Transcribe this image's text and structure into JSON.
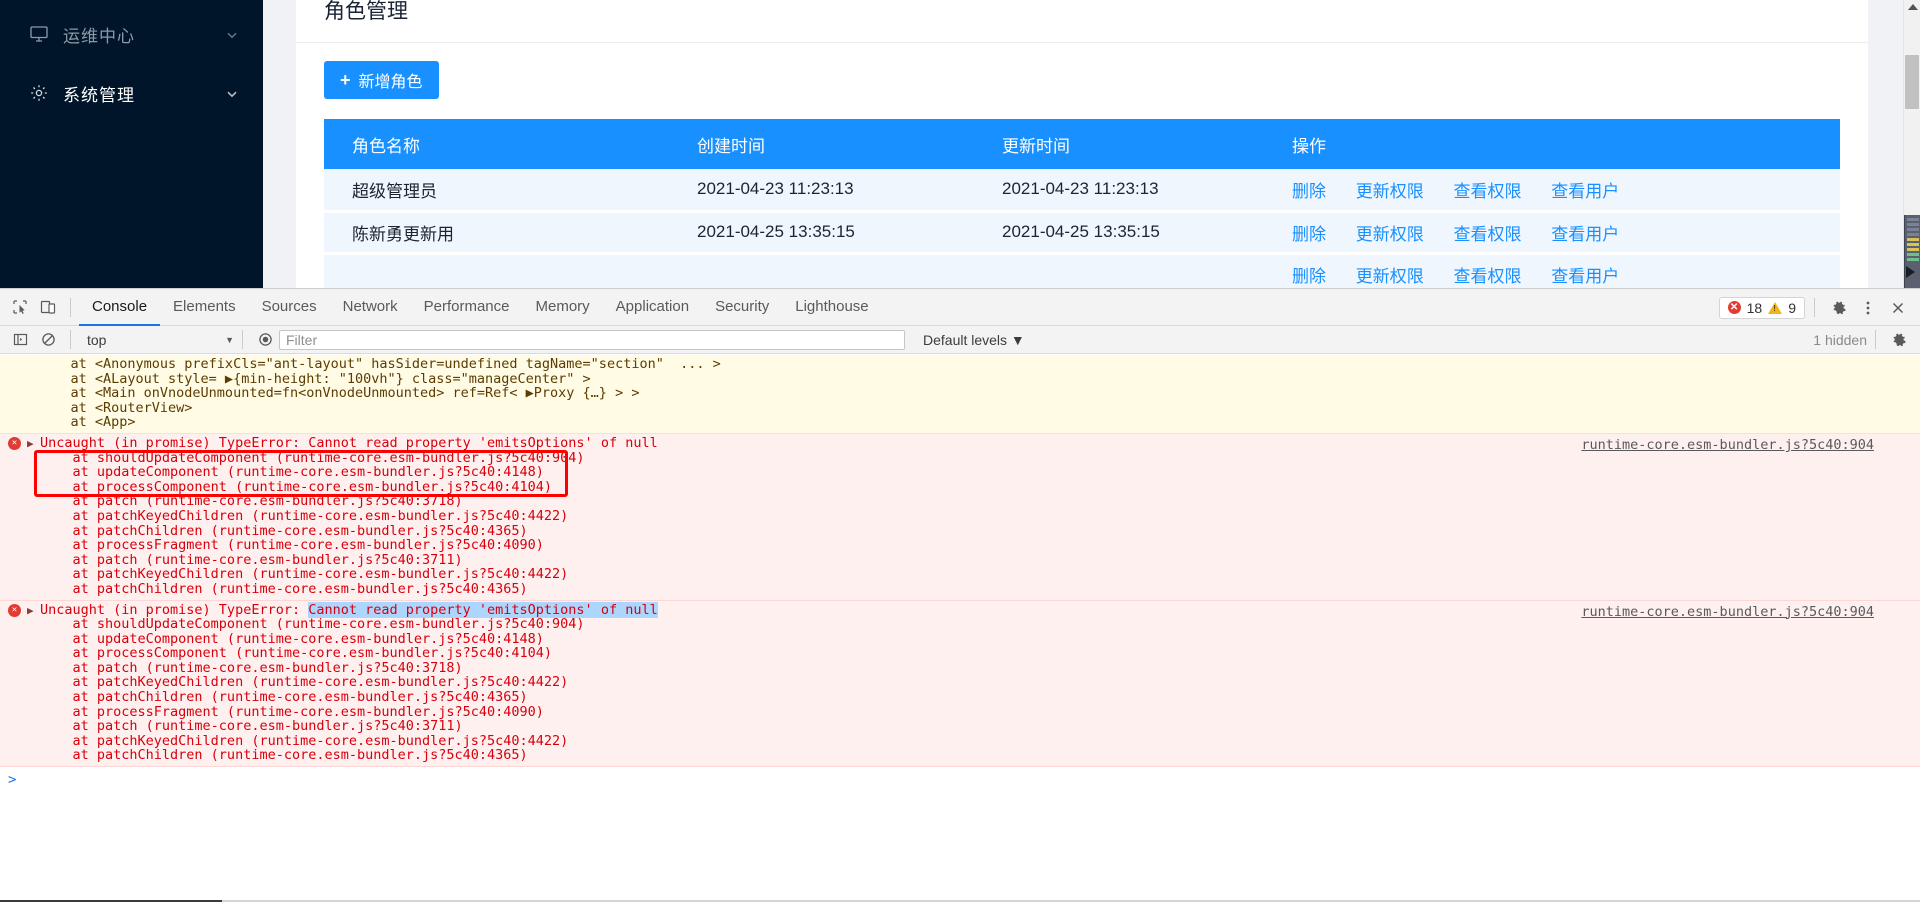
{
  "sidebar": {
    "items": [
      {
        "label": "运维中心",
        "icon": "monitor-icon",
        "active": false
      },
      {
        "label": "系统管理",
        "icon": "gear-icon",
        "active": true
      }
    ]
  },
  "page": {
    "title": "角色管理",
    "add_button": "新增角色",
    "add_button_plus": "+",
    "table": {
      "headers": [
        "角色名称",
        "创建时间",
        "更新时间",
        "操作"
      ],
      "rows": [
        {
          "name": "超级管理员",
          "created": "2021-04-23 11:23:13",
          "updated": "2021-04-23 11:23:13",
          "ops": [
            "删除",
            "更新权限",
            "查看权限",
            "查看用户"
          ]
        },
        {
          "name": "陈新勇更新用",
          "created": "2021-04-25 13:35:15",
          "updated": "2021-04-25 13:35:15",
          "ops": [
            "删除",
            "更新权限",
            "查看权限",
            "查看用户"
          ]
        },
        {
          "name": "",
          "created": "",
          "updated": "",
          "ops": [
            "删除",
            "更新权限",
            "查看权限",
            "查看用户"
          ]
        }
      ]
    }
  },
  "devtools": {
    "tabs": [
      "Console",
      "Elements",
      "Sources",
      "Network",
      "Performance",
      "Memory",
      "Application",
      "Security",
      "Lighthouse"
    ],
    "selected_tab": "Console",
    "error_count": "18",
    "warning_count": "9",
    "error_badge_glyph": "✕",
    "settings_icon": "gear-icon",
    "more_icon": "kebab-menu-icon",
    "close_icon": "close-icon",
    "filterbar": {
      "context": "top",
      "context_caret": "▼",
      "filter_placeholder": "Filter",
      "filter_value": "",
      "levels": "Default levels ▼",
      "hidden_label": "1 hidden"
    },
    "console": {
      "warn_block": {
        "lines": [
          "    at <Anonymous prefixCls=\"ant-layout\" hasSider=undefined tagName=\"section\"  ... >",
          "    at <ALayout style= ▶{min-height: \"100vh\"} class=\"manageCenter\" >",
          "    at <Main onVnodeUnmounted=fn<onVnodeUnmounted> ref=Ref< ▶Proxy {…} > >",
          "    at <RouterView>",
          "    at <App>"
        ]
      },
      "error1": {
        "title_prefix": "Uncaught (in promise) TypeError: ",
        "title_message": "Cannot read property 'emitsOptions' of null",
        "source": "runtime-core.esm-bundler.js?5c40:904",
        "stack": [
          "    at shouldUpdateComponent (runtime-core.esm-bundler.js?5c40:904)",
          "    at updateComponent (runtime-core.esm-bundler.js?5c40:4148)",
          "    at processComponent (runtime-core.esm-bundler.js?5c40:4104)",
          "    at patch (runtime-core.esm-bundler.js?5c40:3718)",
          "    at patchKeyedChildren (runtime-core.esm-bundler.js?5c40:4422)",
          "    at patchChildren (runtime-core.esm-bundler.js?5c40:4365)",
          "    at processFragment (runtime-core.esm-bundler.js?5c40:4090)",
          "    at patch (runtime-core.esm-bundler.js?5c40:3711)",
          "    at patchKeyedChildren (runtime-core.esm-bundler.js?5c40:4422)",
          "    at patchChildren (runtime-core.esm-bundler.js?5c40:4365)"
        ]
      },
      "error2": {
        "title_prefix": "Uncaught (in promise) TypeError: ",
        "title_message": "Cannot read property 'emitsOptions' of null",
        "source": "runtime-core.esm-bundler.js?5c40:904",
        "stack": [
          "    at shouldUpdateComponent (runtime-core.esm-bundler.js?5c40:904)",
          "    at updateComponent (runtime-core.esm-bundler.js?5c40:4148)",
          "    at processComponent (runtime-core.esm-bundler.js?5c40:4104)",
          "    at patch (runtime-core.esm-bundler.js?5c40:3718)",
          "    at patchKeyedChildren (runtime-core.esm-bundler.js?5c40:4422)",
          "    at patchChildren (runtime-core.esm-bundler.js?5c40:4365)",
          "    at processFragment (runtime-core.esm-bundler.js?5c40:4090)",
          "    at patch (runtime-core.esm-bundler.js?5c40:3711)",
          "    at patchKeyedChildren (runtime-core.esm-bundler.js?5c40:4422)",
          "    at patchChildren (runtime-core.esm-bundler.js?5c40:4365)"
        ]
      },
      "prompt_glyph": ">"
    }
  },
  "colors": {
    "accent": "#1890ff",
    "sidebar_bg": "#001529",
    "error_red": "#d8000c",
    "annotation_red": "#ff0000",
    "selection_blue": "#add6ff"
  }
}
